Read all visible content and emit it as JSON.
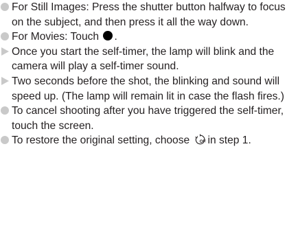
{
  "instructions": [
    {
      "marker": "bullet",
      "text": "For Still Images: Press the shutter button halfway to focus on the subject, and then press it all the way down."
    },
    {
      "marker": "bullet",
      "text_before": "For Movies: Touch",
      "icon": "record-dot-icon",
      "text_after": "."
    },
    {
      "marker": "arrow",
      "text": "Once you start the self-timer, the lamp will blink and the camera will play a self-timer sound."
    },
    {
      "marker": "arrow",
      "text": "Two seconds before the shot, the blinking and sound will speed up. (The lamp will remain lit in case the flash fires.)"
    },
    {
      "marker": "bullet",
      "text": "To cancel shooting after you have triggered the self-timer, touch the screen."
    },
    {
      "marker": "bullet",
      "text_before": "To restore the original setting, choose",
      "icon": "self-timer-off-icon",
      "text_after": "in step 1."
    }
  ],
  "colors": {
    "text": "#231f20",
    "marker": "#c9c9c9",
    "record_dot": "#000000"
  }
}
